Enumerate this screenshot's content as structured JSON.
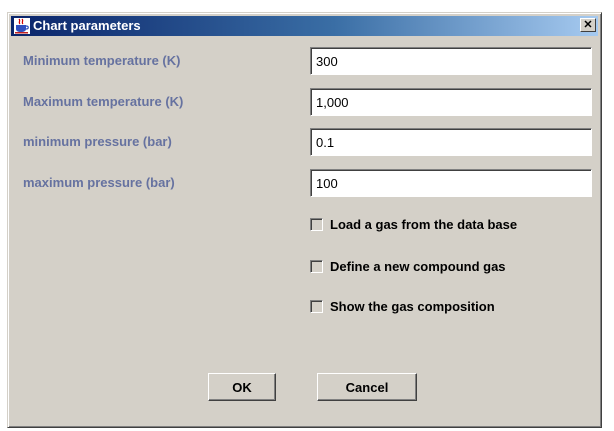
{
  "window": {
    "title": "Chart parameters",
    "close_glyph": "✕"
  },
  "fields": [
    {
      "label": "Minimum temperature (K)",
      "value": "300"
    },
    {
      "label": "Maximum temperature (K)",
      "value": "1,000"
    },
    {
      "label": "minimum pressure (bar)",
      "value": "0.1"
    },
    {
      "label": "maximum pressure (bar)",
      "value": "100"
    }
  ],
  "options": [
    {
      "label": "Load a gas from the data base",
      "checked": false
    },
    {
      "label": "Define a new compound gas",
      "checked": false
    },
    {
      "label": "Show the gas composition",
      "checked": false
    }
  ],
  "buttons": {
    "ok": "OK",
    "cancel": "Cancel"
  },
  "colors": {
    "label_text": "#6672a0",
    "titlebar_start": "#0a246a",
    "titlebar_end": "#a6caf0",
    "dialog_bg": "#d4d0c8"
  },
  "icons": {
    "window_icon": "java-cup-icon",
    "close": "close-icon"
  }
}
